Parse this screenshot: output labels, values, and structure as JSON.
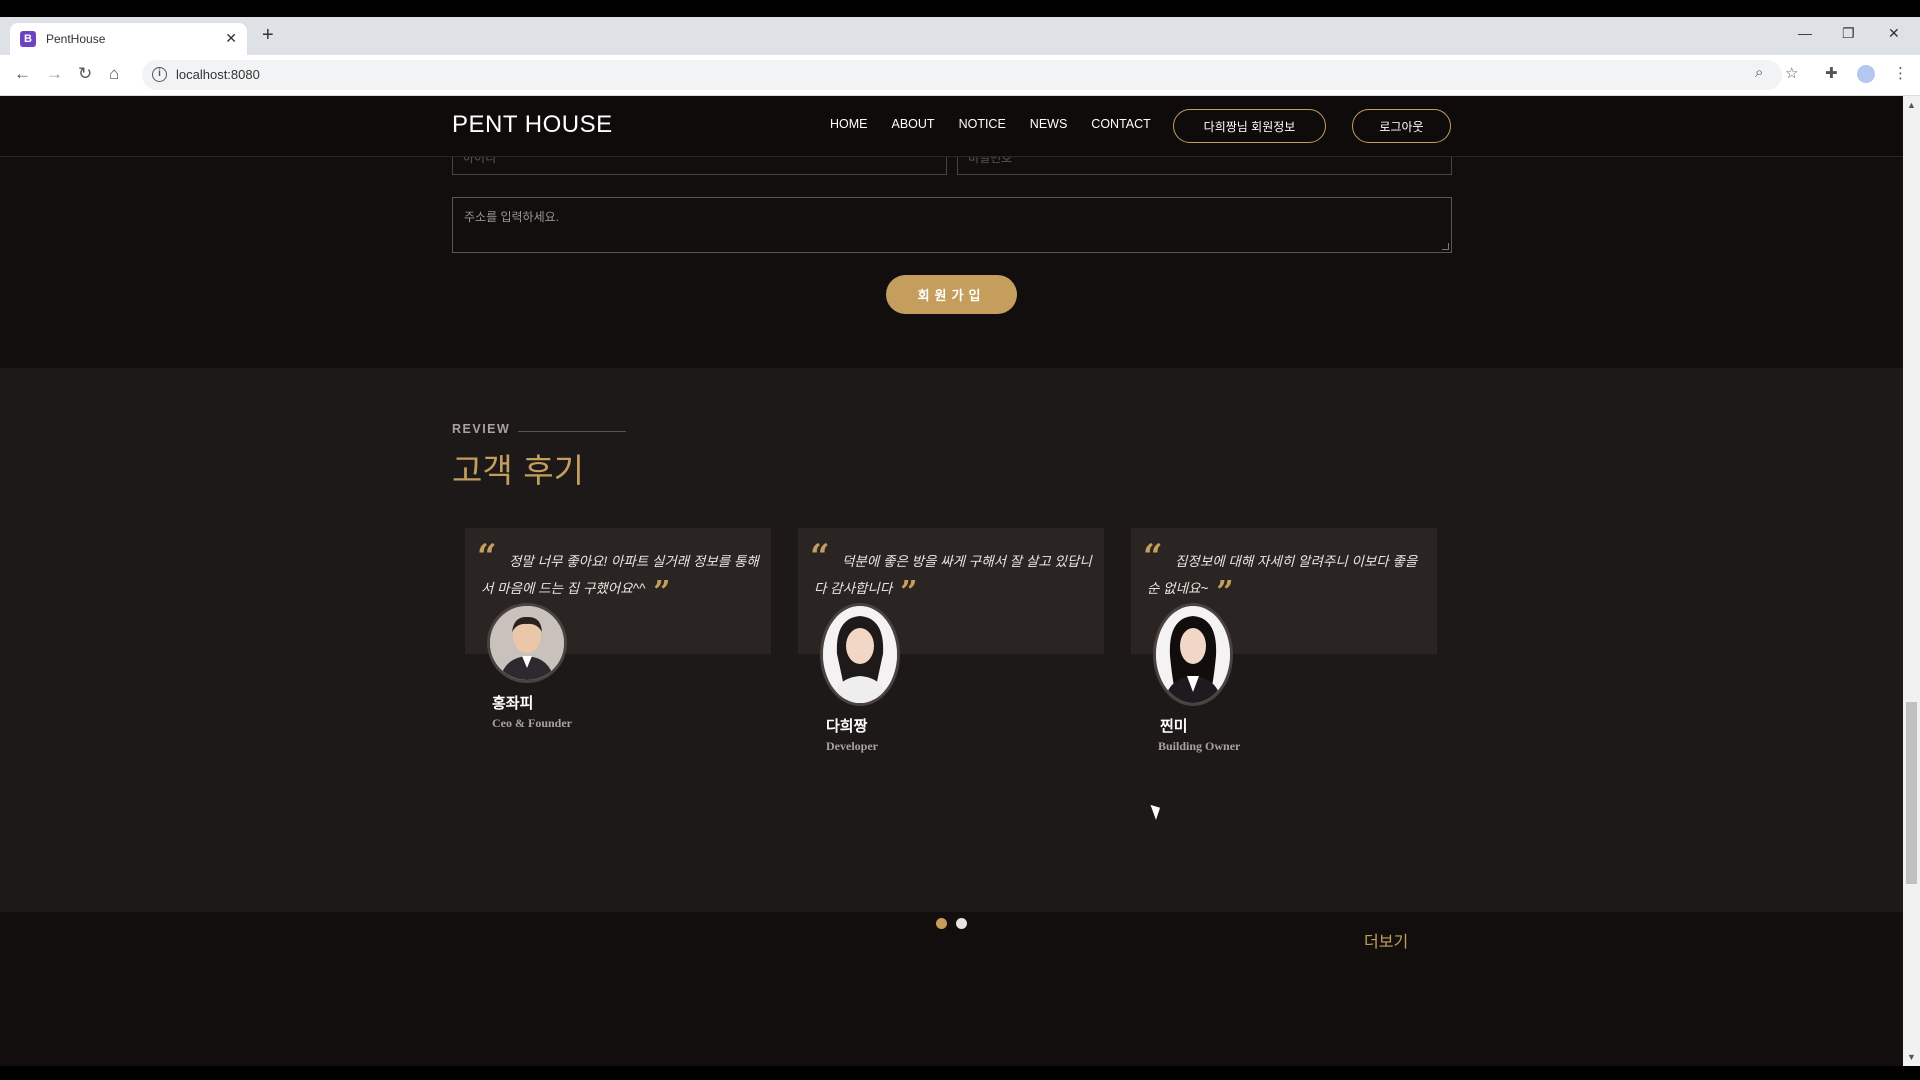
{
  "browser": {
    "tab_title": "PentHouse",
    "tab_favicon": "B",
    "url": "localhost:8080"
  },
  "form": {
    "id_placeholder": "아이디",
    "password_placeholder": "비밀번호",
    "address_placeholder": "주소를 입력하세요.",
    "signup_label": "회원가입"
  },
  "navbar": {
    "logo": "PENT HOUSE",
    "links": [
      "HOME",
      "ABOUT",
      "NOTICE",
      "NEWS",
      "CONTACT"
    ],
    "profile_label": "다희짱님 회원정보",
    "logout_label": "로그아웃"
  },
  "review": {
    "eyebrow": "REVIEW",
    "title": "고객 후기",
    "items": [
      {
        "quote": "정말 너무 좋아요! 아파트 실거래 정보를 통해서 마음에 드는 집 구했어요^^",
        "name": "홍좌피",
        "role": "Ceo & Founder"
      },
      {
        "quote": "덕분에 좋은 방을 싸게 구해서 잘 살고 있답니다 감사합니다",
        "name": "다희짱",
        "role": "Developer"
      },
      {
        "quote": "집정보에 대해 자세히 알려주니 이보다 좋을 순 없네요~",
        "name": "찐미",
        "role": "Building Owner"
      }
    ],
    "more_label": "더보기"
  },
  "colors": {
    "accent": "#c59e5e",
    "page_bg": "#120e0e",
    "section_bg": "#1d1918",
    "card_bg": "#2a2422"
  }
}
